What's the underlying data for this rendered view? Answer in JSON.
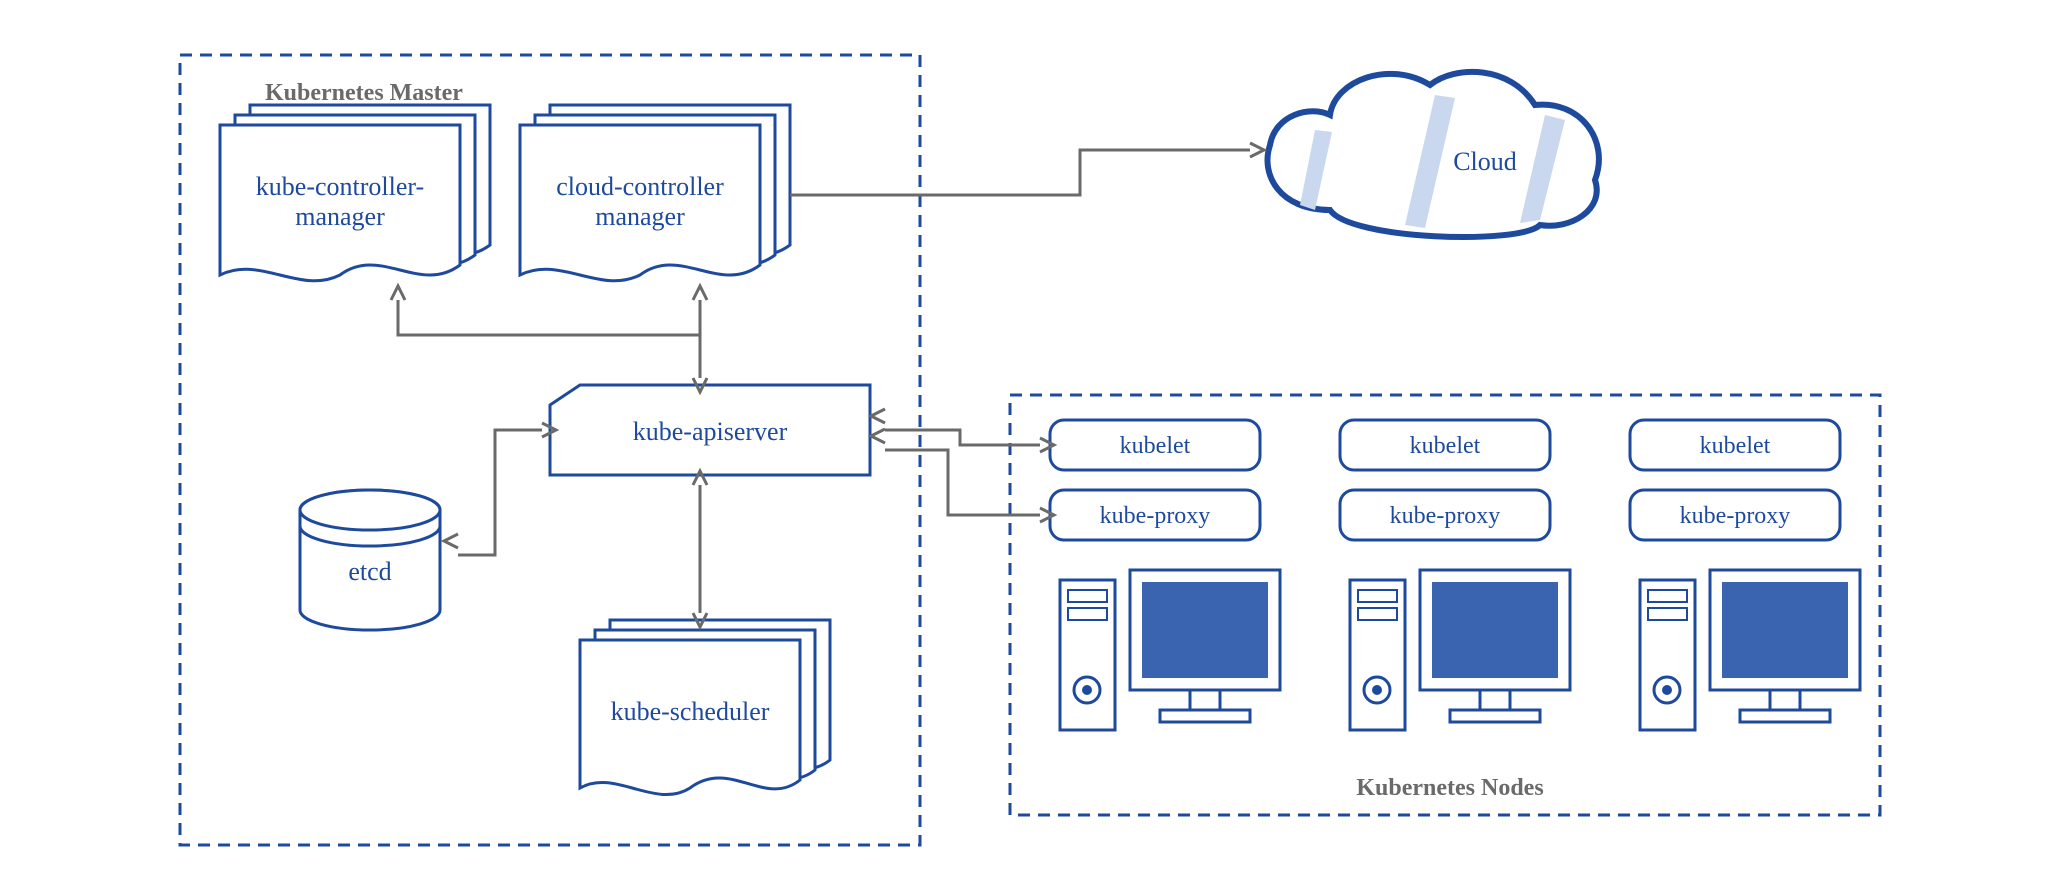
{
  "master": {
    "title": "Kubernetes Master",
    "components": {
      "kube_controller_manager_l1": "kube-controller-",
      "kube_controller_manager_l2": "manager",
      "cloud_controller_manager_l1": "cloud-controller",
      "cloud_controller_manager_l2": "manager",
      "kube_apiserver": "kube-apiserver",
      "etcd": "etcd",
      "kube_scheduler": "kube-scheduler"
    }
  },
  "cloud": {
    "label": "Cloud"
  },
  "nodes": {
    "title": "Kubernetes Nodes",
    "items": [
      {
        "kubelet": "kubelet",
        "kube_proxy": "kube-proxy"
      },
      {
        "kubelet": "kubelet",
        "kube_proxy": "kube-proxy"
      },
      {
        "kubelet": "kubelet",
        "kube_proxy": "kube-proxy"
      }
    ]
  },
  "colors": {
    "primary": "#1e4a9e",
    "grey": "#6a6a6a",
    "shade": "#c9d8ef",
    "fill": "#3a64b0"
  }
}
